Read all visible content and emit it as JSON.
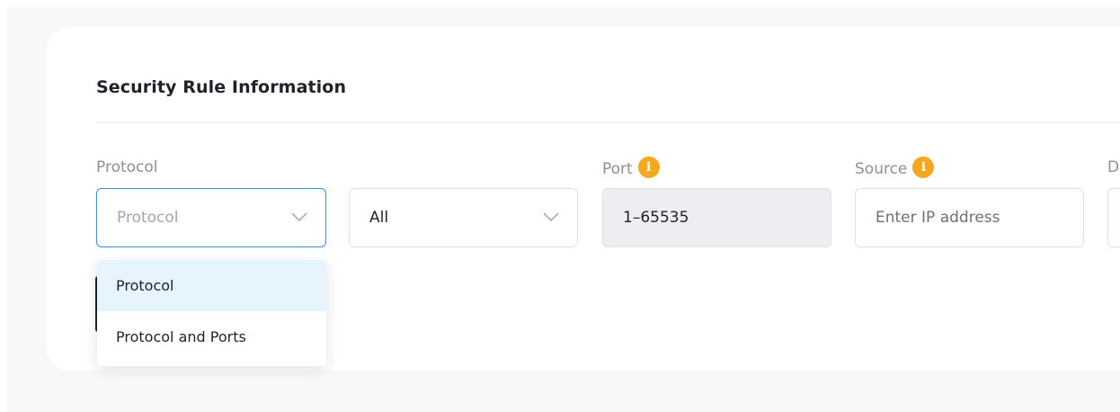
{
  "section": {
    "title": "Security Rule Information"
  },
  "fields": {
    "protocol_label": "Protocol",
    "protocol_select_value": "Protocol",
    "traffic_select_value": "All",
    "port_label": "Port",
    "port_value": "1–65535",
    "source_label": "Source",
    "source_placeholder": "Enter IP address",
    "next_label_fragment": "D"
  },
  "dropdown": {
    "options": [
      {
        "label": "Protocol",
        "selected": true
      },
      {
        "label": "Protocol and Ports",
        "selected": false
      }
    ]
  },
  "icons": {
    "info": "info-icon",
    "chevron": "chevron-down-icon"
  },
  "colors": {
    "accent_focus": "#3b8de0",
    "info_badge": "#f4a81d",
    "selected_option_bg": "#e6f4fd",
    "disabled_field_bg": "#eceef1"
  }
}
